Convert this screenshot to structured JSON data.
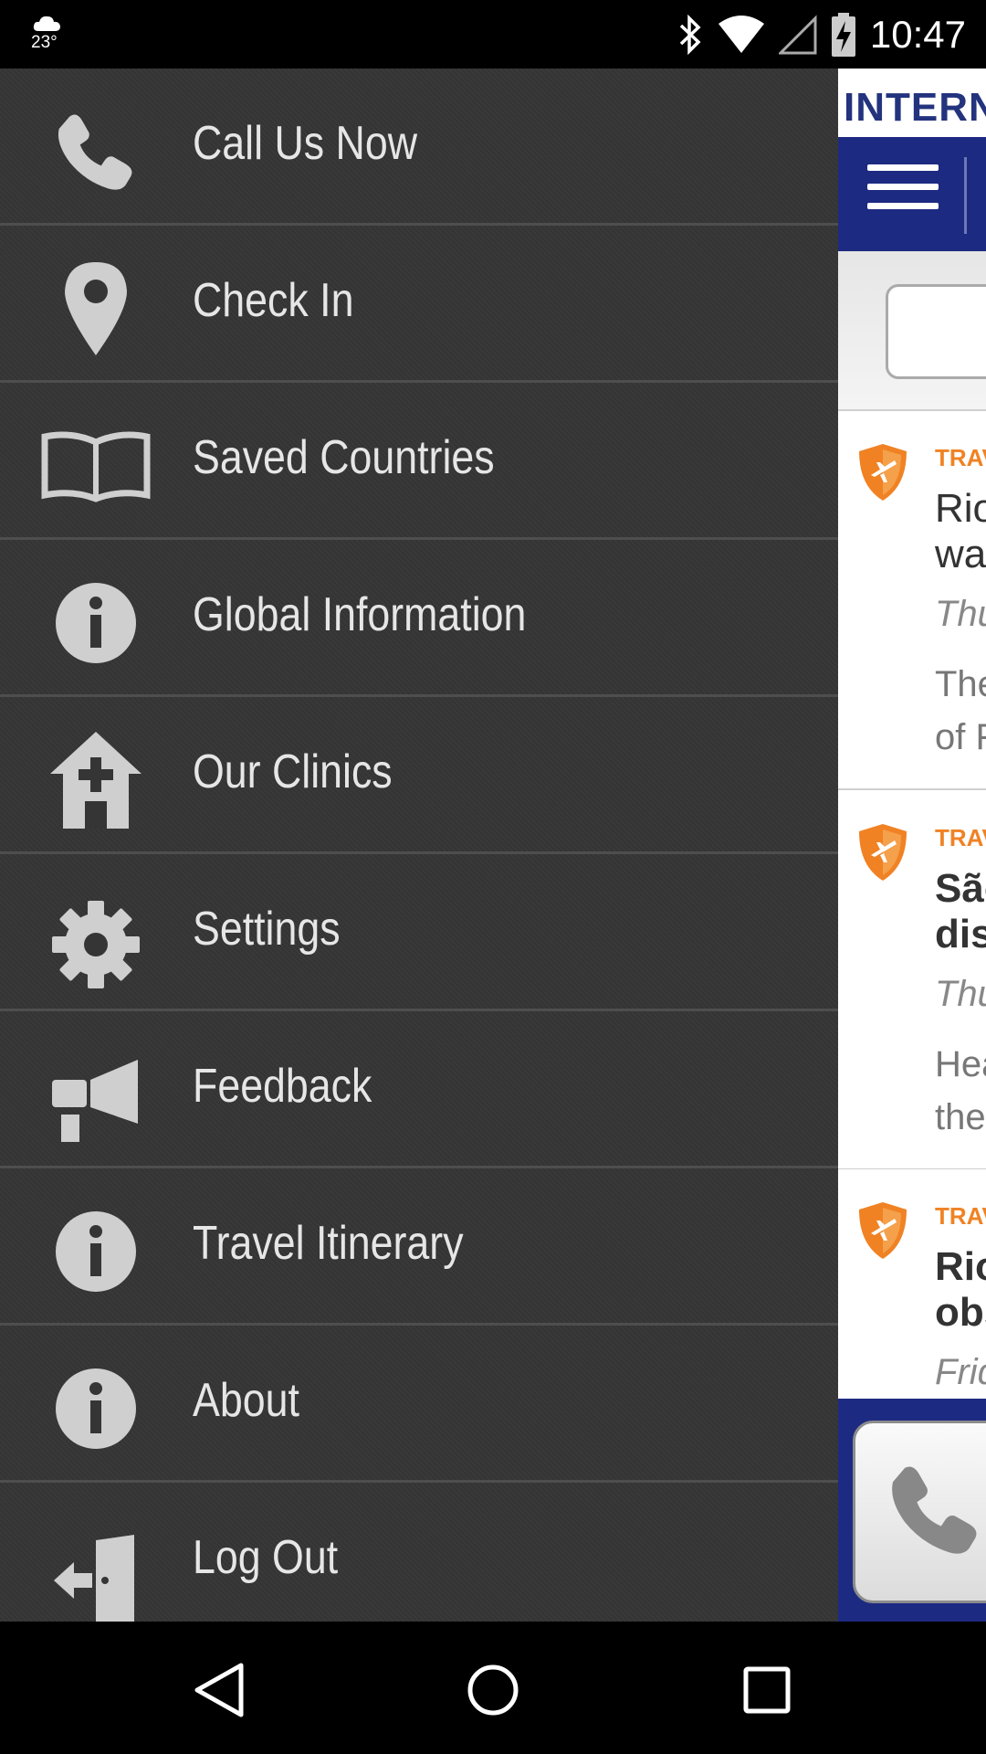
{
  "status_bar": {
    "weather_icon": "cloud-icon",
    "temperature": "23°",
    "time": "10:47",
    "icons": [
      "bluetooth-icon",
      "wifi-icon",
      "cell-signal-icon",
      "battery-charging-icon"
    ]
  },
  "drawer": {
    "items": [
      {
        "label": "Call Us Now",
        "icon": "phone-icon"
      },
      {
        "label": "Check In",
        "icon": "location-pin-icon"
      },
      {
        "label": "Saved Countries",
        "icon": "open-book-icon"
      },
      {
        "label": "Global Information",
        "icon": "info-icon"
      },
      {
        "label": "Our Clinics",
        "icon": "clinic-house-icon"
      },
      {
        "label": "Settings",
        "icon": "gear-icon"
      },
      {
        "label": "Feedback",
        "icon": "megaphone-icon"
      },
      {
        "label": "Travel Itinerary",
        "icon": "info-icon"
      },
      {
        "label": "About",
        "icon": "info-icon"
      },
      {
        "label": "Log Out",
        "icon": "logout-door-icon"
      }
    ]
  },
  "app": {
    "logo_text": "INTERN",
    "news": [
      {
        "category": "TRAV",
        "title": "Rio\nwar",
        "date": "Thu",
        "summary": "The\nof F"
      },
      {
        "category": "TRAV",
        "title": "São\ndisr",
        "date": "Thu",
        "summary": "Hea\nthe"
      },
      {
        "category": "TRAV",
        "title": "Rio\nobs",
        "date": "Frid",
        "summary": ""
      }
    ]
  },
  "colors": {
    "drawer_bg": "#353535",
    "navbar_blue": "#1d2a82",
    "accent_orange": "#f08224"
  }
}
